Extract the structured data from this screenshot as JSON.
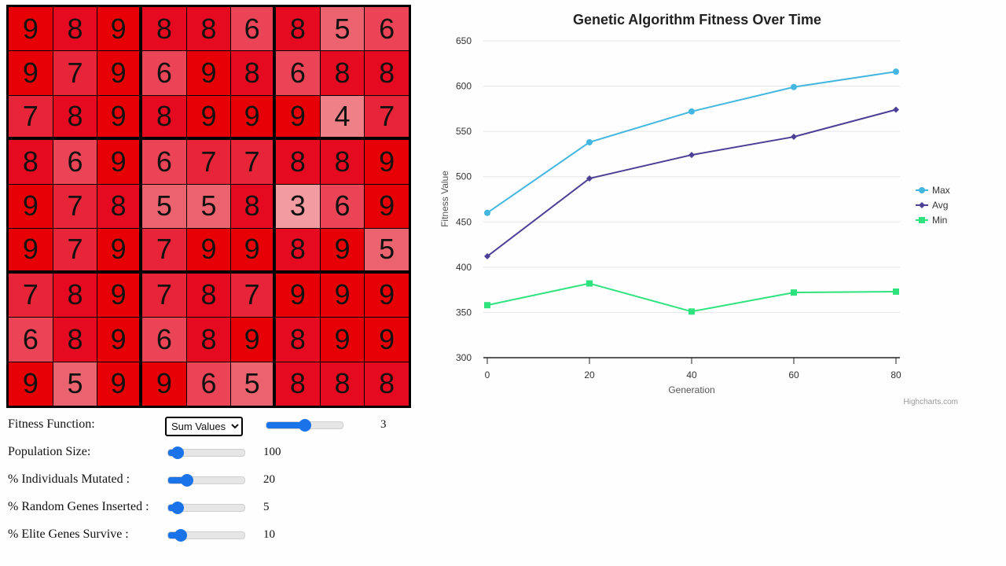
{
  "grid": {
    "rows": [
      [
        9,
        8,
        9,
        8,
        8,
        6,
        8,
        5,
        6
      ],
      [
        9,
        7,
        9,
        6,
        9,
        8,
        6,
        8,
        8
      ],
      [
        7,
        8,
        9,
        8,
        9,
        9,
        9,
        4,
        7
      ],
      [
        8,
        6,
        9,
        6,
        7,
        7,
        8,
        8,
        9
      ],
      [
        9,
        7,
        8,
        5,
        5,
        8,
        3,
        6,
        9
      ],
      [
        9,
        7,
        9,
        7,
        9,
        9,
        8,
        9,
        5
      ],
      [
        7,
        8,
        9,
        7,
        8,
        7,
        9,
        9,
        9
      ],
      [
        6,
        8,
        9,
        6,
        8,
        9,
        8,
        9,
        9
      ],
      [
        9,
        5,
        9,
        9,
        6,
        5,
        8,
        8,
        8
      ]
    ]
  },
  "controls": {
    "fitness_function": {
      "label": "Fitness Function:",
      "selected": "Sum Values",
      "slider_value": 3,
      "slider_min": 1,
      "slider_max": 5,
      "value_text": "3"
    },
    "population_size": {
      "label": "Population Size:",
      "value": 100,
      "min": 50,
      "max": 1000,
      "value_text": "100"
    },
    "individuals_mutated": {
      "label": "% Individuals Mutated :",
      "value": 20,
      "min": 0,
      "max": 100,
      "value_text": "20"
    },
    "random_genes_inserted": {
      "label": "% Random Genes Inserted :",
      "value": 5,
      "min": 0,
      "max": 100,
      "value_text": "5"
    },
    "elite_genes_survive": {
      "label": "% Elite Genes Survive :",
      "value": 10,
      "min": 0,
      "max": 100,
      "value_text": "10"
    }
  },
  "credits": "Highcharts.com",
  "chart_data": {
    "type": "line",
    "title": "Genetic Algorithm Fitness Over Time",
    "xlabel": "Generation",
    "ylabel": "Fitness Value",
    "x": [
      0,
      20,
      40,
      60,
      80
    ],
    "xticks": [
      0,
      20,
      40,
      60,
      80
    ],
    "yticks": [
      300,
      350,
      400,
      450,
      500,
      550,
      600,
      650
    ],
    "ylim": [
      300,
      650
    ],
    "xlim": [
      0,
      80
    ],
    "grid": true,
    "legend_position": "right",
    "series": [
      {
        "name": "Max",
        "color": "#44b7e0",
        "marker": "circle",
        "values": [
          460,
          538,
          572,
          599,
          616
        ]
      },
      {
        "name": "Avg",
        "color": "#4b3f96",
        "marker": "diamond",
        "values": [
          412,
          498,
          524,
          544,
          574
        ]
      },
      {
        "name": "Min",
        "color": "#2ee37e",
        "marker": "square",
        "values": [
          358,
          382,
          351,
          372,
          373
        ]
      }
    ]
  }
}
